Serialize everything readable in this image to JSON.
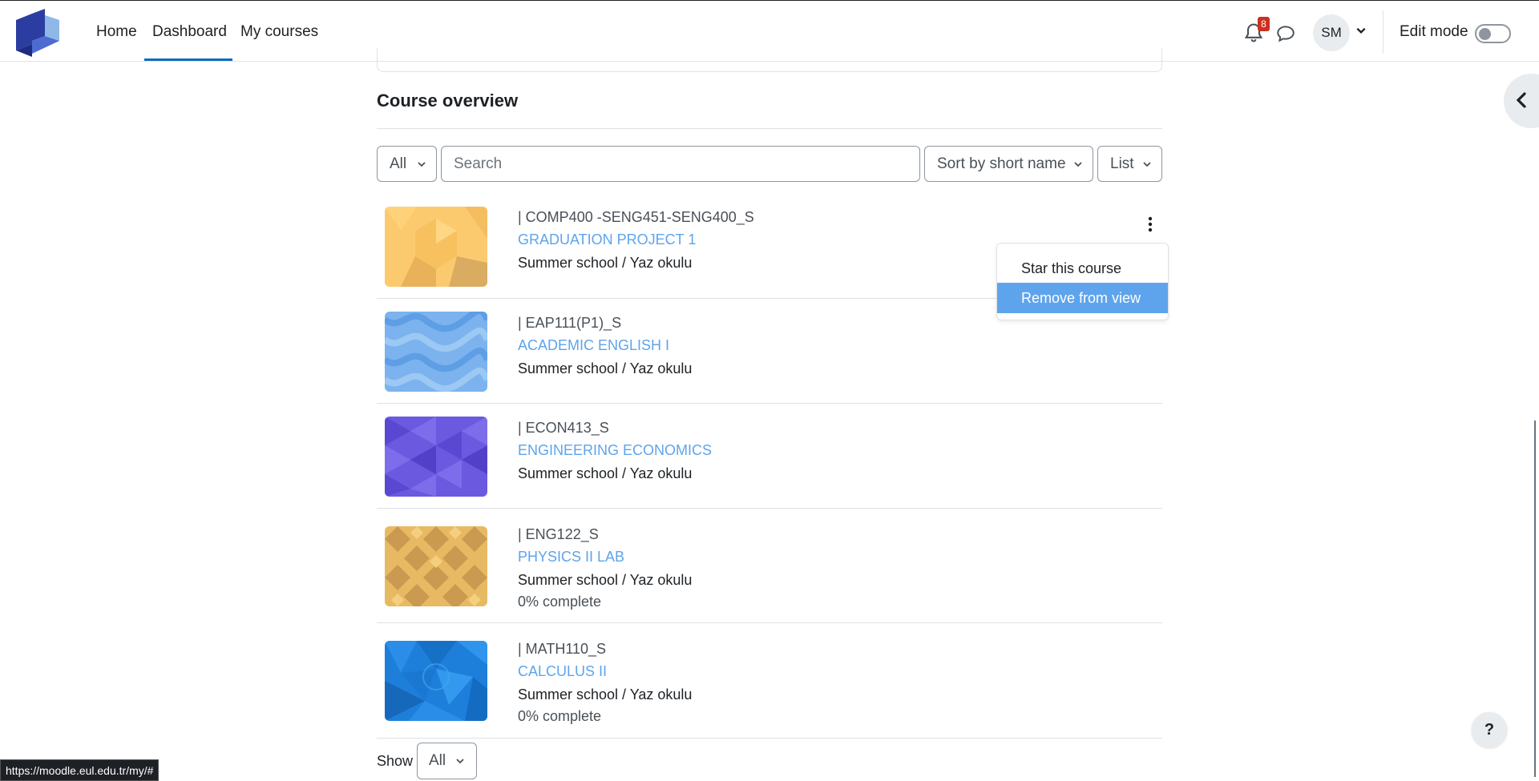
{
  "nav": {
    "home": "Home",
    "dashboard": "Dashboard",
    "my_courses": "My courses",
    "notification_count": "8",
    "avatar_initials": "SM",
    "edit_mode": "Edit mode",
    "edit_mode_on": false
  },
  "overview": {
    "title": "Course overview",
    "filter_label": "All",
    "search_placeholder": "Search",
    "sort_label": "Sort by short name",
    "view_label": "List"
  },
  "courses": [
    {
      "short": "| COMP400 -SENG451-SENG400_S",
      "name": "GRADUATION PROJECT 1",
      "category": "Summer school / Yaz okulu",
      "progress": ""
    },
    {
      "short": "| EAP111(P1)_S",
      "name": "ACADEMIC ENGLISH I",
      "category": "Summer school / Yaz okulu",
      "progress": ""
    },
    {
      "short": "| ECON413_S",
      "name": "ENGINEERING ECONOMICS",
      "category": "Summer school / Yaz okulu",
      "progress": ""
    },
    {
      "short": "| ENG122_S",
      "name": "PHYSICS II LAB",
      "category": "Summer school / Yaz okulu",
      "progress": "0% complete"
    },
    {
      "short": "| MATH110_S",
      "name": "CALCULUS II",
      "category": "Summer school / Yaz okulu",
      "progress": "0% complete"
    }
  ],
  "menu": {
    "star": "Star this course",
    "remove": "Remove from view"
  },
  "footer": {
    "show_label": "Show",
    "show_value": "All",
    "status_url": "https://moodle.eul.edu.tr/my/#",
    "help": "?"
  },
  "colors": {
    "accent": "#0f6cbf",
    "link": "#5ea4ec",
    "badge": "#ca3120"
  }
}
